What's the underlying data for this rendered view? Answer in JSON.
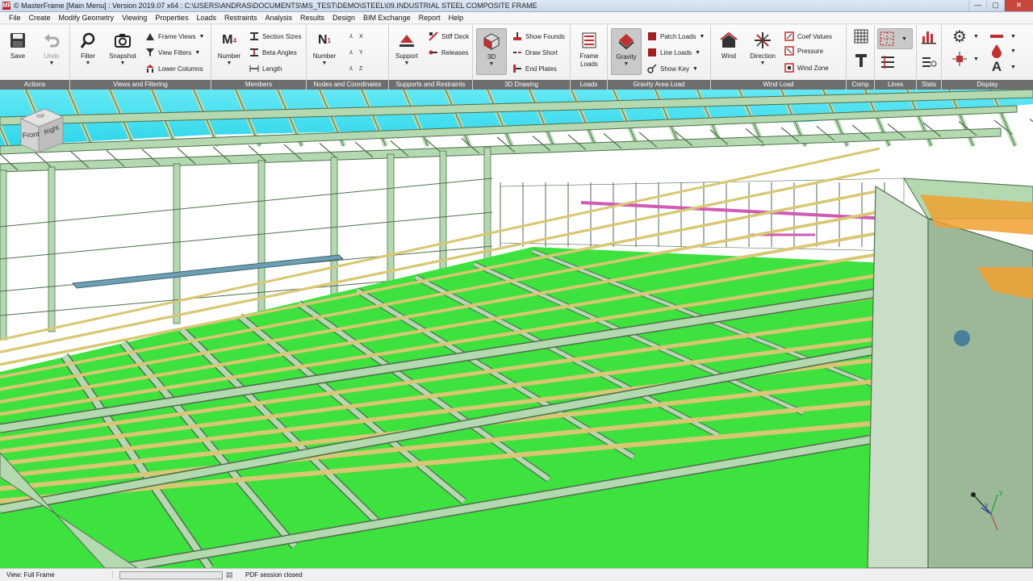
{
  "title_bar": {
    "app_icon": "MF",
    "title": "© MasterFrame [Main Menu] : Version 2019.07 x64 : C:\\USERS\\ANDRAS\\DOCUMENTS\\MS_TEST\\DEMO\\STEEL\\09.INDUSTRIAL STEEL COMPOSITE FRAME",
    "minimize": "—",
    "maximize": "▢",
    "close": "✕"
  },
  "menu": [
    "File",
    "Create",
    "Modify Geometry",
    "Viewing",
    "Properties",
    "Loads",
    "Restraints",
    "Analysis",
    "Results",
    "Design",
    "BIM Exchange",
    "Report",
    "Help"
  ],
  "ribbon": {
    "groups": {
      "actions": "Actions",
      "views": "Views and Filtering",
      "members": "Members",
      "nodes": "Nodes and Coordinates",
      "supports": "Supports and Restraints",
      "drawing": "3D Drawing",
      "loads": "Loads",
      "gravity": "Gravity Area Load",
      "wind": "Wind Load",
      "comp": "Comp",
      "lines": "Lines",
      "stats": "Stats",
      "display": "Display"
    },
    "buttons": {
      "save": "Save",
      "undo": "Undo",
      "filter": "Filter",
      "snapshot": "Snapshot",
      "frame_views": "Frame Views",
      "view_filters": "View Filters",
      "lower_columns": "Lower Columns",
      "member_number": "Number",
      "section_sizes": "Section Sizes",
      "beta_angles": "Beta Angles",
      "length": "Length",
      "node_number": "Number",
      "support": "Support",
      "stiff_deck": "Stiff Deck",
      "releases": "Releases",
      "three_d": "3D",
      "show_founds": "Show Founds",
      "draw_short": "Draw Short",
      "end_plates": "End Plates",
      "frame_loads": "Frame Loads",
      "gravity": "Gravity",
      "patch_loads": "Patch Loads",
      "line_loads": "Line Loads",
      "show_key": "Show Key",
      "wind": "Wind",
      "direction": "Direction",
      "coef_values": "Coef Values",
      "pressure": "Pressure",
      "wind_zone": "Wind Zone"
    },
    "icon_letters": {
      "member_m": "M",
      "member_sub": "4",
      "node_n": "N",
      "node_sub": "1",
      "axis_x": "X",
      "axis_y": "Y",
      "axis_z": "Z",
      "display_a": "A"
    }
  },
  "viewport": {
    "view_cube": {
      "front": "Front",
      "right": "Right",
      "top": "Top"
    },
    "axis_labels": {
      "x": "x",
      "y": "y"
    },
    "colors": {
      "slab": "#3ee23e",
      "member": "#b4d9b0",
      "member_edge": "#4e6e4c",
      "joist": "#d8c773",
      "roof_glass": "#43e2f2",
      "bracing_pink": "#d05ab4",
      "orange": "#f0a030"
    }
  },
  "status": {
    "view": "View: Full Frame",
    "pdf": "PDF session closed"
  },
  "icons": [
    "save-icon",
    "undo-icon",
    "filter-icon",
    "snapshot-icon",
    "frame-views-icon",
    "view-filters-icon",
    "lower-columns-icon",
    "support-icon",
    "cube-3d-icon",
    "gravity-icon",
    "wind-icon",
    "direction-icon",
    "grid-icon",
    "bar-chart-icon",
    "gear-icon",
    "text-a-icon"
  ]
}
